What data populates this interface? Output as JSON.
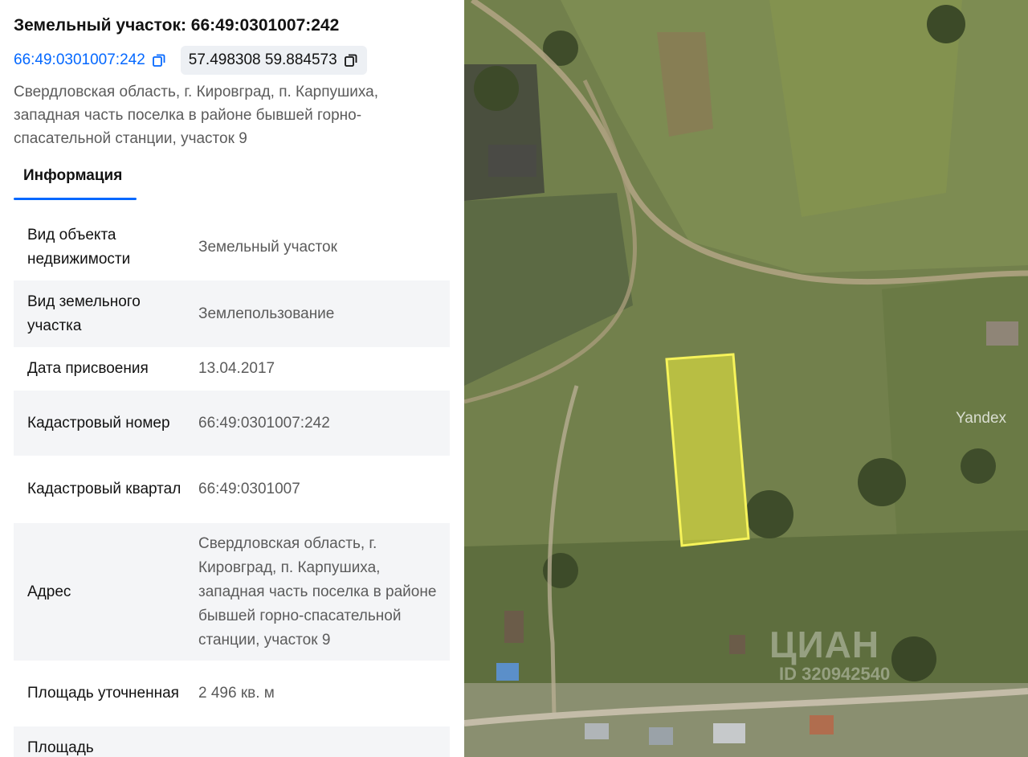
{
  "header": {
    "title": "Земельный участок: 66:49:0301007:242",
    "cadastral_link": "66:49:0301007:242",
    "coordinates": "57.498308 59.884573",
    "address": "Свердловская область, г. Кировград, п. Карпушиха, западная часть поселка в районе бывшей горно-спасательной станции, участок 9"
  },
  "tabs": [
    {
      "label": "Информация",
      "active": true
    }
  ],
  "info_rows": [
    {
      "key": "Вид объекта недвижимости",
      "value": "Земельный участок"
    },
    {
      "key": "Вид земельного участка",
      "value": "Землепользование"
    },
    {
      "key": "Дата присвоения",
      "value": "13.04.2017"
    },
    {
      "key": "Кадастровый номер",
      "value": "66:49:0301007:242"
    },
    {
      "key": "Кадастровый квартал",
      "value": "66:49:0301007"
    },
    {
      "key": "Адрес",
      "value": "Свердловская область, г. Кировград, п. Карпушиха, западная часть поселка в районе бывшей горно-спасательной станции, участок 9"
    },
    {
      "key": "Площадь уточненная",
      "value": "2 496 кв. м"
    },
    {
      "key": "Площадь",
      "value": ""
    }
  ],
  "map": {
    "provider_watermark": "Yandex",
    "cian_watermark": "ЦИАН",
    "listing_id": "ID 320942540",
    "plot_color": "#f2f03c"
  },
  "colors": {
    "accent": "#0468ff",
    "muted": "#5b5b5b",
    "row_alt": "#f4f5f7"
  }
}
